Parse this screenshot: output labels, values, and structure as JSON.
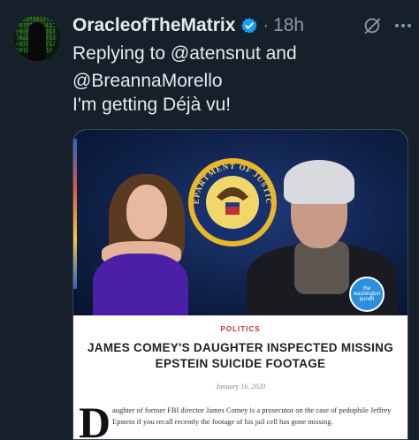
{
  "tweet": {
    "username": "OracleofTheMatrix",
    "time": "18h",
    "separator": "·",
    "reply_line_1": "Replying to @atensnut and",
    "reply_line_2": "@BreannaMorello",
    "text": "I'm getting Déjà vu!"
  },
  "avatar": {
    "glyphs": "ｱ1ｶ0ｻﾀ01ﾅﾊ1ﾏﾔ0ﾗﾜ1ｲｷ0ｼﾁ1ﾆﾋ0ﾐﾘ1ｳｸ0ｽﾂ1ﾇﾌ0ﾑﾙ1ｴｹ0ｾﾃ1ﾈﾍ0ﾒﾚ1ｵｺ0ｿﾄ1ﾉﾎ0ﾓﾛ1ｱ0ｶﾀ1ﾅ"
  },
  "icons": {
    "verified": "verified-badge-icon",
    "grok": "grok-icon",
    "more": "more-icon"
  },
  "card": {
    "category": "POLITICS",
    "headline_1": "JAMES COMEY'S DAUGHTER INSPECTED MISSING",
    "headline_2": "EPSTEIN SUICIDE FOOTAGE",
    "date": "January 16, 2020",
    "dropcap": "D",
    "body_line_1": "aughter of former FBI director James Comey is a prosecutor on the case of pedophile Jeffrey",
    "body_line_2": "Epstein if you recall recently the footage of his jail cell has gone missing.",
    "seal_text": "DEPARTMENT OF JUSTICE",
    "badge_text": "the washington pundit"
  },
  "colors": {
    "background": "#15202b",
    "text": "#e7e9ea",
    "muted": "#8b98a5",
    "verified": "#1d9bf0",
    "category": "#c9302c"
  }
}
